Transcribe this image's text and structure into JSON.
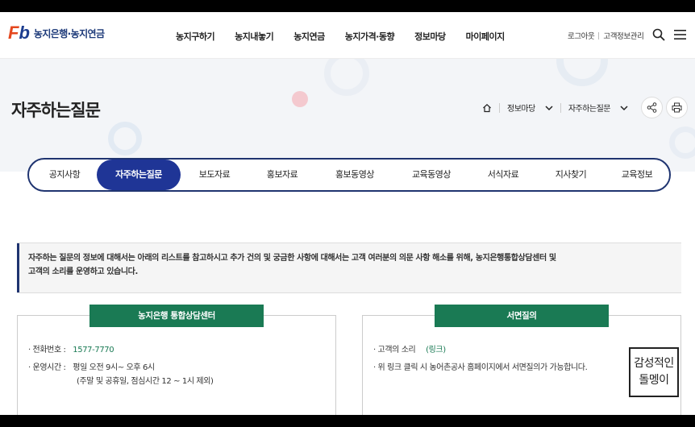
{
  "header": {
    "logo_mark_f": "F",
    "logo_mark_b": "b",
    "logo_text": "농지은행·농지연금",
    "nav": [
      "농지구하기",
      "농지내놓기",
      "농지연금",
      "농지가격·동향",
      "정보마당",
      "마이페이지"
    ],
    "logout": "로그아웃",
    "customer_info": "고객정보관리"
  },
  "hero": {
    "title": "자주하는질문",
    "breadcrumb": [
      "정보마당",
      "자주하는질문"
    ]
  },
  "tabs": [
    "공지사항",
    "자주하는질문",
    "보도자료",
    "홍보자료",
    "홍보동영상",
    "교육동영상",
    "서식자료",
    "지사찾기",
    "교육정보"
  ],
  "active_tab": "자주하는질문",
  "notice": {
    "line1": "자주하는 질문의 정보에 대해서는 아래의 리스트를 참고하시고 추가 건의 및 궁금한 사항에 대해서는 고객 여러분의 의문 사항 해소를 위해, 농지은행통합상담센터 및",
    "line2": "고객의 소리를 운영하고 있습니다."
  },
  "center": {
    "title": "농지은행 통합상담센터",
    "phone_label": "· 전화번호 :",
    "phone": "1577-7770",
    "hours_label": "· 운영시간 :",
    "hours": "평일 오전 9시~ 오후 6시",
    "hours_note": "(주말 및 공휴일, 점심시간 12 ~ 1시 제외)"
  },
  "written": {
    "title": "서면질의",
    "voice_label": "· 고객의 소리",
    "voice_link": "(링크)",
    "desc": "· 위 링크 클릭 시 농어촌공사 홈페이지에서 서면질의가 가능합니다."
  },
  "stamp": {
    "line1": "감성적인",
    "line2": "돌멩이"
  },
  "colors": {
    "navy": "#1f3470",
    "active_tab": "#1f3596",
    "green": "#1a7a54"
  }
}
